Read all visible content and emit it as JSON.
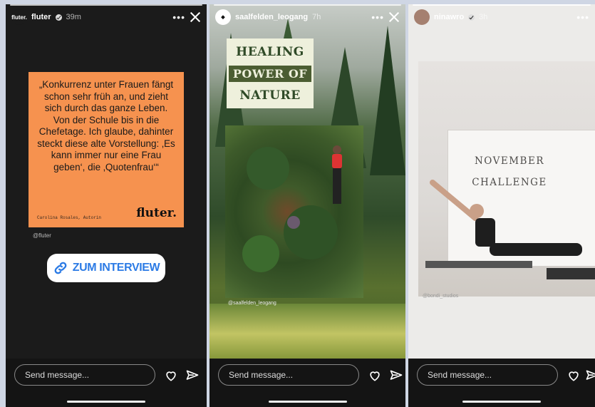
{
  "stories": [
    {
      "user": "fluter",
      "time": "39m",
      "logo": "fluter.",
      "quote": "„Konkurrenz unter Frauen fängt schon sehr früh an, und zieht sich durch das ganze Leben. Von der Schule bis in die Chefetage. Ich glaube, dahinter steckt diese alte Vorstellung: ‚Es kann immer nur eine Frau geben‘, die ‚Quotenfrau‘“",
      "author": "Carolina Rosales, Autorin",
      "quote_logo": "fluter.",
      "handle": "@fluter",
      "cta": "ZUM INTERVIEW",
      "message_placeholder": "Send message..."
    },
    {
      "user": "saalfelden_leogang",
      "time": "7h",
      "title_lines": [
        "HEALING",
        "POWER OF",
        "NATURE"
      ],
      "handle": "@saalfelden_leogang",
      "message_placeholder": "Send message..."
    },
    {
      "user": "ninawro",
      "time": "3h",
      "challenge_lines": [
        "NOVEMBER",
        "CHALLENGE"
      ],
      "handle": "@bondi_studios",
      "message_placeholder": "Send message..."
    }
  ],
  "colors": {
    "quote_card": "#f6924f",
    "cta_text": "#2c7be5",
    "title_bg": "#eef0dc",
    "title_green": "#2f4a27"
  },
  "icons": [
    "verified-icon",
    "more-icon",
    "close-icon",
    "heart-icon",
    "send-icon",
    "link-icon"
  ]
}
